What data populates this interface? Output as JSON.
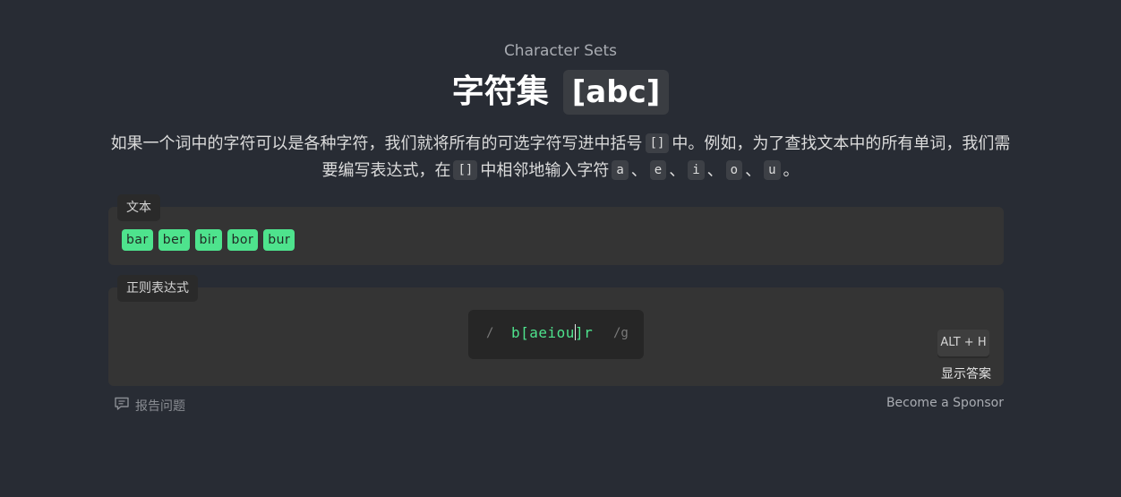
{
  "header": {
    "subtitle": "Character Sets",
    "title": "字符集",
    "title_code": "[abc]"
  },
  "description": {
    "part1": "如果一个词中的字符可以是各种字符，我们就将所有的可选字符写进中括号",
    "code1": "[]",
    "part2": "中。例如，为了查找文本中的所有单词，我们需要编写表达式，在",
    "code2": "[]",
    "part3": "中相邻地输入字符",
    "chars": [
      "a",
      "e",
      "i",
      "o",
      "u"
    ],
    "separator": "、",
    "end": "。"
  },
  "text_panel": {
    "label": "文本",
    "matches": [
      "bar",
      "ber",
      "bir",
      "bor",
      "bur"
    ]
  },
  "regex_panel": {
    "label": "正则表达式",
    "slash": "/",
    "value_before_caret": "b[aeiou",
    "value_after_caret": "]r",
    "flags": "/g",
    "shortcut": "ALT + H",
    "show_answer": "显示答案"
  },
  "footer": {
    "report_issue": "报告问题",
    "sponsor": "Become a Sponsor"
  },
  "colors": {
    "background": "#282c34",
    "panel": "#343434",
    "match": "#4ee38d"
  }
}
